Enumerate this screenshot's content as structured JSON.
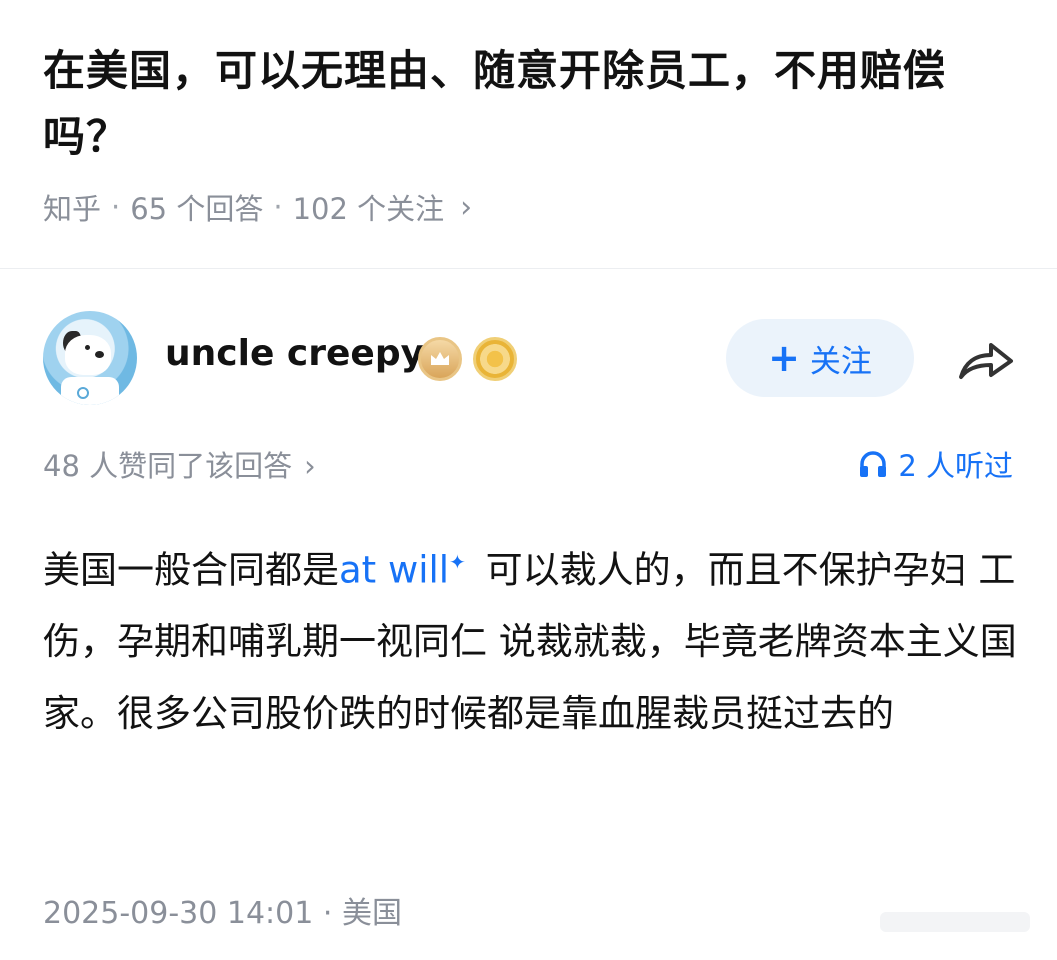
{
  "question": {
    "title": "在美国，可以无理由、随意开除员工，不用赔偿吗？",
    "source": "知乎",
    "answers": "65 个回答",
    "followers": "102 个关注"
  },
  "author": {
    "name": "uncle creepy",
    "follow_label": "关注"
  },
  "stats": {
    "likes": "48 人赞同了该回答",
    "listened": "2 人听过"
  },
  "answer": {
    "part1": "美国一般合同都是",
    "link": "at will",
    "part2": " 可以裁人的，而且不保护孕妇 工伤，孕期和哺乳期一视同仁 说裁就裁，毕竟老牌资本主义国家。很多公司股价跌的时候都是靠血腥裁员挺过去的"
  },
  "footer": {
    "timestamp": "2025-09-30 14:01",
    "location": "美国"
  },
  "colors": {
    "accent": "#1772f6",
    "meta": "#8a8f99",
    "follow_bg": "#ebf3fb"
  }
}
